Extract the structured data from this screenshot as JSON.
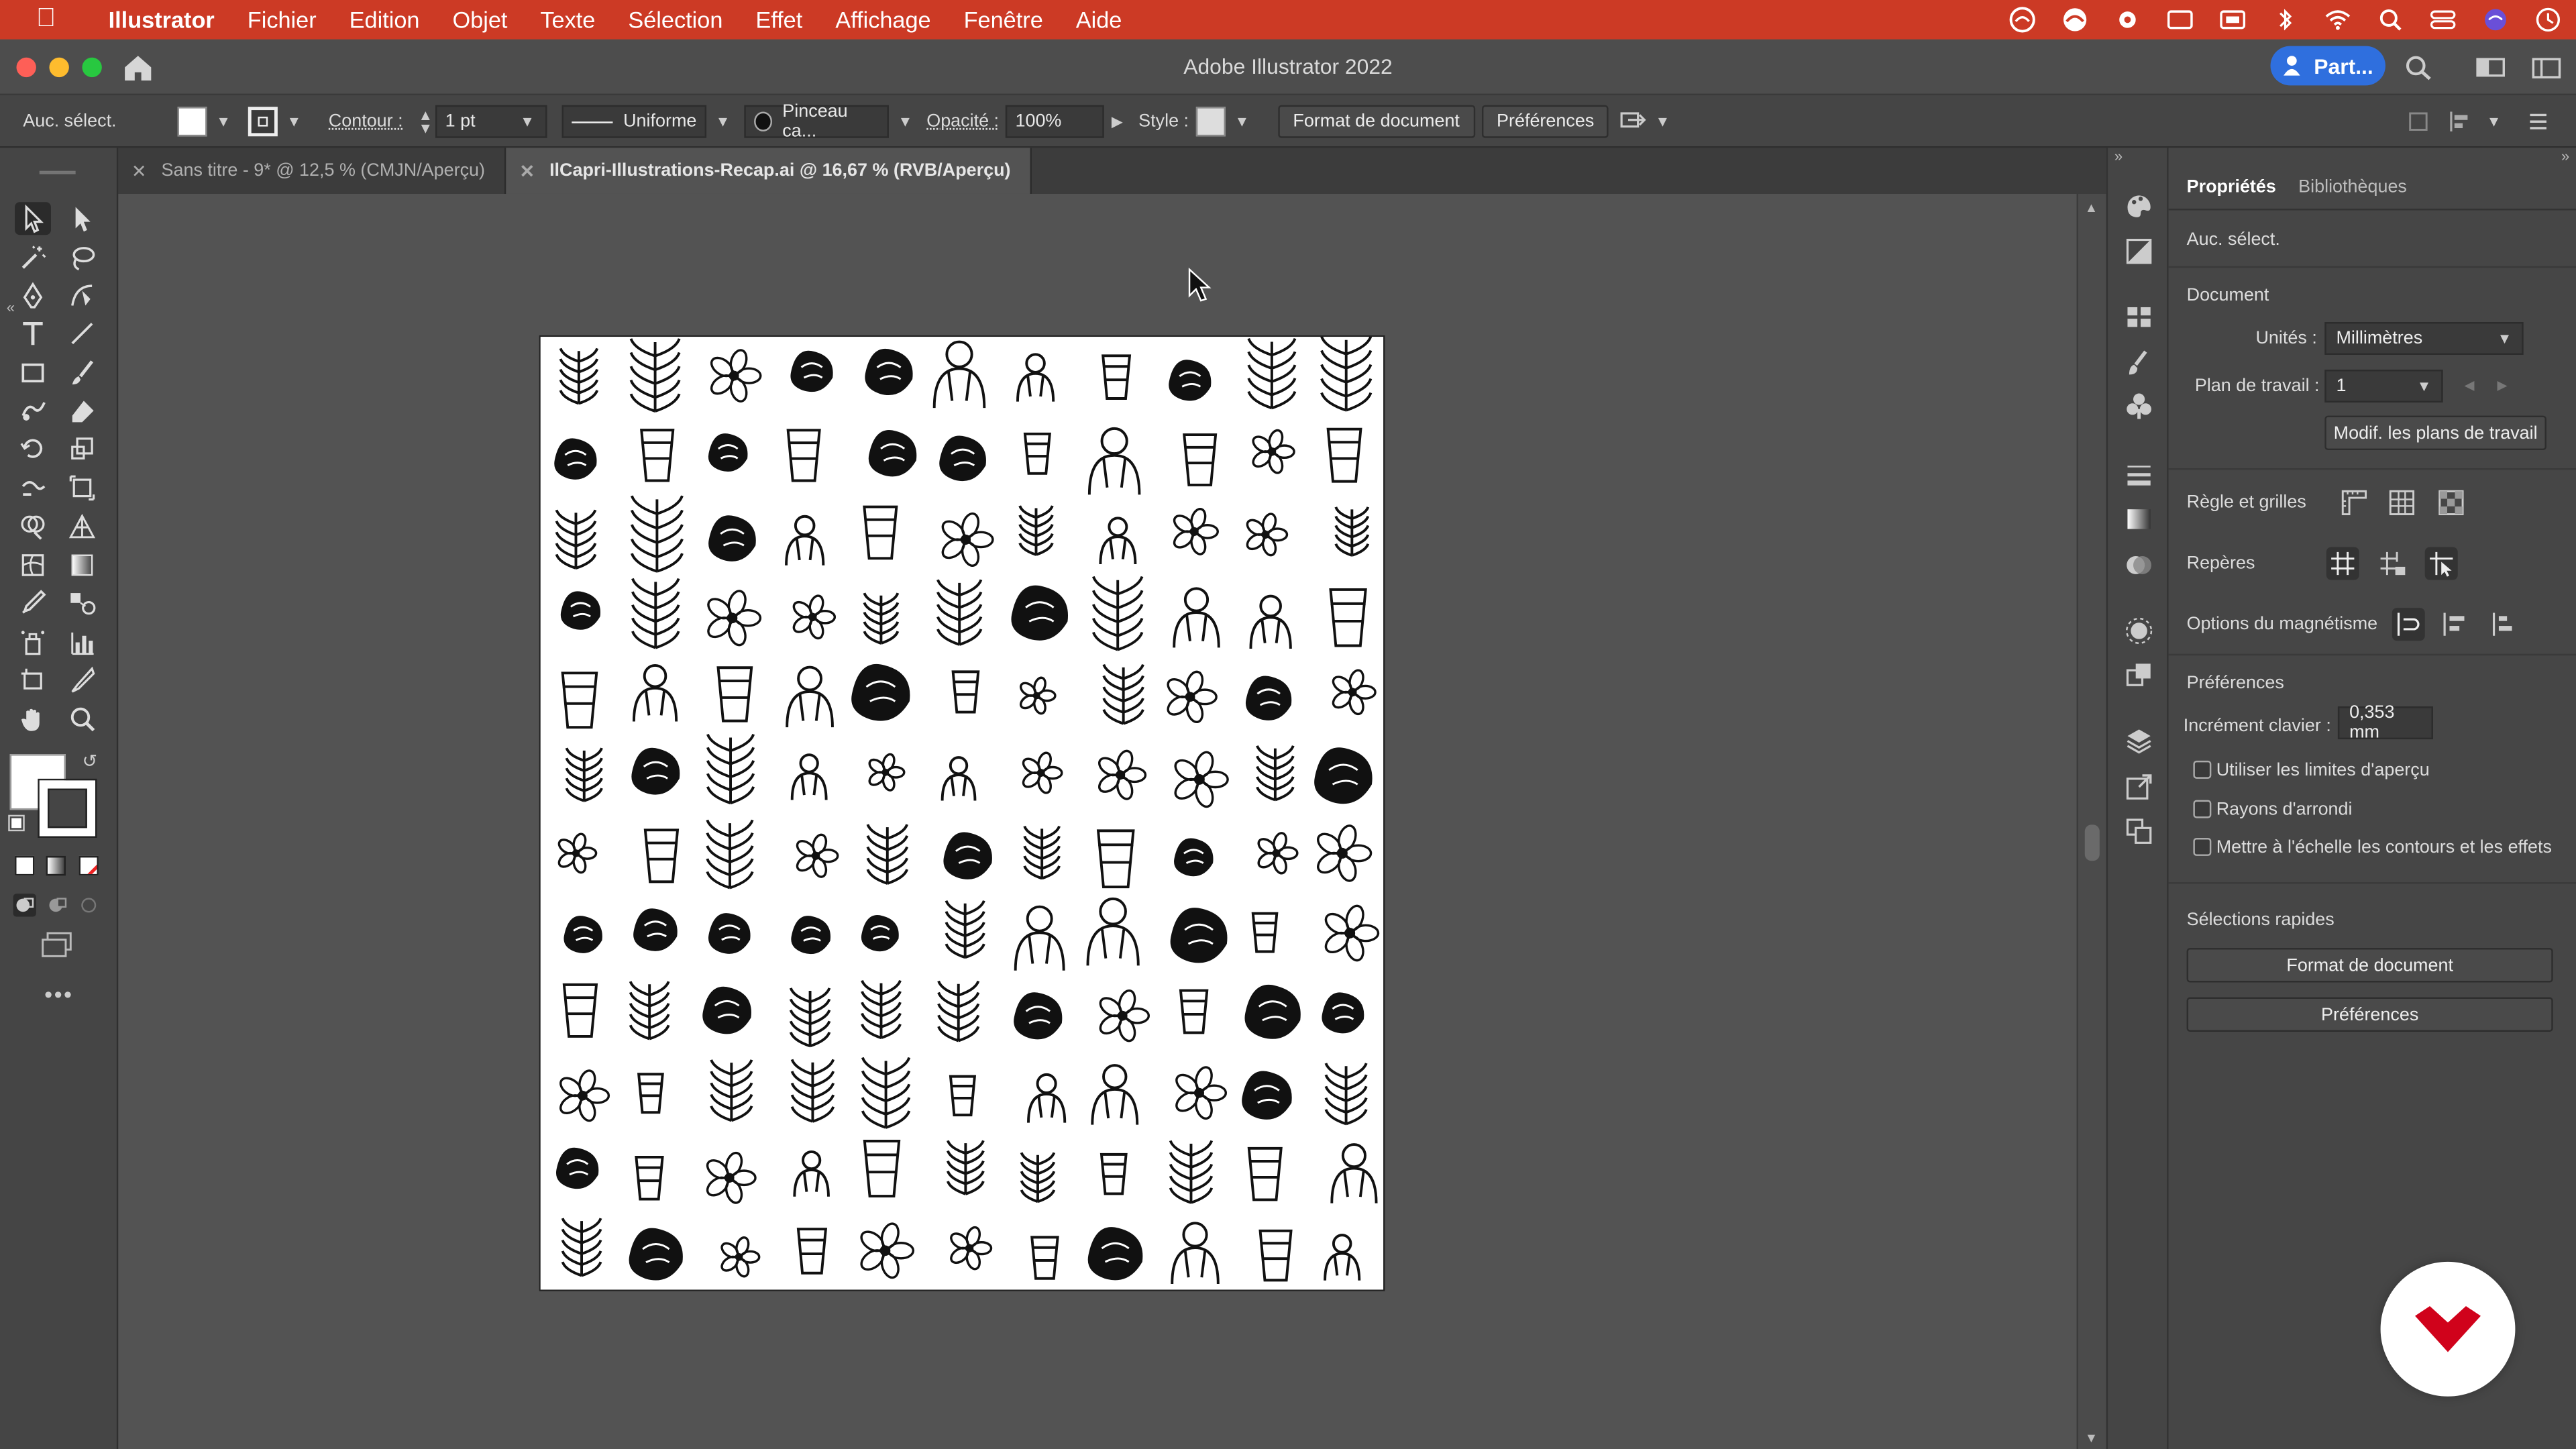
{
  "menubar": {
    "app_name": "Illustrator",
    "items": [
      "Fichier",
      "Edition",
      "Objet",
      "Texte",
      "Sélection",
      "Effet",
      "Affichage",
      "Fenêtre",
      "Aide"
    ]
  },
  "titlebar": {
    "title": "Adobe Illustrator 2022",
    "share_label": "Part..."
  },
  "controlbar": {
    "selection": "Auc. sélect.",
    "stroke_label": "Contour :",
    "stroke_value": "1 pt",
    "profile": "Uniforme",
    "brush": "Pinceau ca...",
    "opacity_label": "Opacité :",
    "opacity_value": "100%",
    "style_label": "Style :",
    "doc_setup": "Format de document",
    "prefs": "Préférences"
  },
  "tabs": [
    {
      "label": "Sans titre - 9* @ 12,5 % (CMJN/Aperçu)",
      "active": false
    },
    {
      "label": "IlCapri-Illustrations-Recap.ai @ 16,67 % (RVB/Aperçu)",
      "active": true
    }
  ],
  "panel": {
    "tab_properties": "Propriétés",
    "tab_libraries": "Bibliothèques",
    "no_selection": "Auc. sélect.",
    "document_section": "Document",
    "units_label": "Unités :",
    "units_value": "Millimètres",
    "artboard_label": "Plan de travail :",
    "artboard_value": "1",
    "edit_artboards": "Modif. les plans de travail",
    "rulers_grids": "Règle et grilles",
    "guides": "Repères",
    "snap_options": "Options du magnétisme",
    "preferences_section": "Préférences",
    "keyboard_increment_label": "Incrément clavier :",
    "keyboard_increment_value": "0,353 mm",
    "use_preview_bounds": "Utiliser les limites d'aperçu",
    "rounded_corners": "Rayons d'arrondi",
    "scale_strokes": "Mettre à l'échelle les contours et les effets",
    "quick_actions": "Sélections rapides",
    "quick_doc_setup": "Format de document",
    "quick_prefs": "Préférences"
  },
  "colors": {
    "menubar": "#cc3a25",
    "share": "#2f6fde",
    "badge": "#d0021b"
  }
}
